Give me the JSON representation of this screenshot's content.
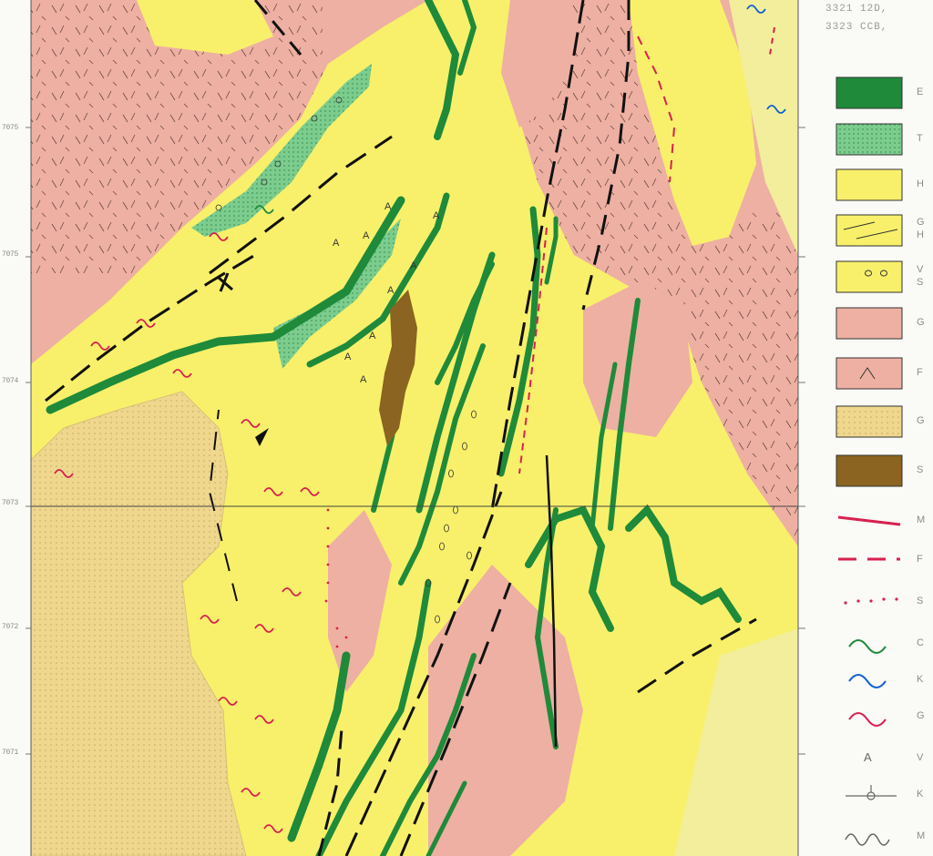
{
  "map": {
    "sheet_codes": [
      "3321 12D,",
      "3323 CCB,"
    ],
    "northing_labels": [
      "7075",
      "7075",
      "7074",
      "7073",
      "7072",
      "7071"
    ],
    "colors": {
      "granite_pink": "#eeb0a2",
      "sediment_yellow": "#f8f06a",
      "volcanic_green": "#1e8a3a",
      "tuff_green": "#7ccc8e",
      "gneiss_tan": "#efd78e",
      "ultramafic_brown": "#8a6420",
      "fault_black": "#111111",
      "fault_red": "#d82050",
      "river_blue": "#1060d0"
    }
  },
  "legend": {
    "items": [
      {
        "icon": "green-fill-swatch",
        "label": "E"
      },
      {
        "icon": "stippled-green-swatch",
        "label": "T"
      },
      {
        "icon": "yellow-swatch",
        "label": "H"
      },
      {
        "icon": "yellow-lined-swatch",
        "label": "G",
        "label2": "H"
      },
      {
        "icon": "yellow-circles-swatch",
        "label": "V",
        "label2": "S"
      },
      {
        "icon": "pink-swatch",
        "label": "G"
      },
      {
        "icon": "pink-hatched-swatch",
        "label": "F"
      },
      {
        "icon": "tan-dotted-swatch",
        "label": "G"
      },
      {
        "icon": "brown-swatch",
        "label": "S"
      },
      {
        "icon": "red-solid-line",
        "label": "M"
      },
      {
        "icon": "red-dashed-line",
        "label": "F"
      },
      {
        "icon": "red-dotted-line",
        "label": "S"
      },
      {
        "icon": "green-wavy-line",
        "label": "C"
      },
      {
        "icon": "blue-wavy-line",
        "label": "K"
      },
      {
        "icon": "red-wavy-line",
        "label": "G"
      },
      {
        "icon": "a-symbol",
        "label": "V"
      },
      {
        "icon": "strike-dip-symbol",
        "label": "K"
      },
      {
        "icon": "meander-symbol",
        "label": "M"
      }
    ]
  }
}
